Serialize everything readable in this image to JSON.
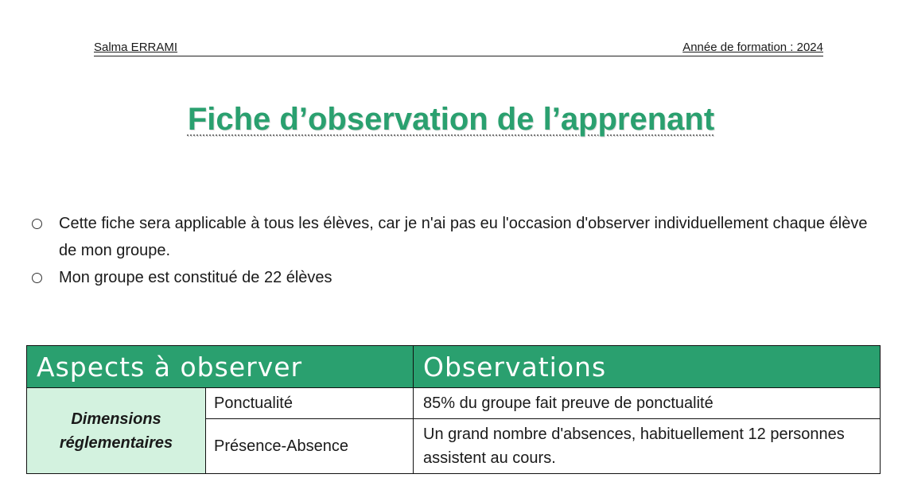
{
  "header": {
    "author": "Salma ERRAMI",
    "year": "Année de formation : 2024"
  },
  "title": "Fiche d’observation de l’apprenant",
  "bullets": [
    "Cette fiche sera applicable à tous les élèves, car je n'ai pas eu l'occasion d'observer individuellement chaque élève de mon groupe.",
    "Mon groupe est constitué de 22 élèves"
  ],
  "table": {
    "headers": [
      "Aspects à observer",
      "Observations"
    ],
    "dimension": "Dimensions réglementaires",
    "rows": [
      {
        "criterion": "Ponctualité",
        "observation": "85% du groupe fait preuve de ponctualité"
      },
      {
        "criterion": "Présence-Absence",
        "observation": "Un grand nombre d'absences, habituellement 12 personnes assistent au cours."
      }
    ]
  },
  "colors": {
    "accent": "#2aa06f",
    "dimension_bg": "#d3f2df"
  }
}
